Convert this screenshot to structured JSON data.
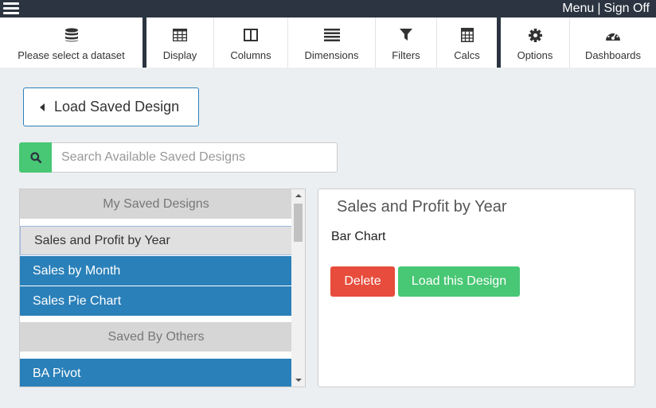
{
  "topbar": {
    "menu_label": "Menu",
    "separator": "|",
    "signoff_label": "Sign Off"
  },
  "toolbar": {
    "dataset_label": "Please select a dataset",
    "display_label": "Display",
    "columns_label": "Columns",
    "dimensions_label": "Dimensions",
    "filters_label": "Filters",
    "calcs_label": "Calcs",
    "options_label": "Options",
    "dashboards_label": "Dashboards"
  },
  "load_button": {
    "label": "Load Saved Design"
  },
  "search": {
    "placeholder": "Search Available Saved Designs",
    "value": ""
  },
  "saved_list": {
    "my_header": "My Saved Designs",
    "my_items": [
      {
        "label": "Sales and Profit by Year",
        "selected": true
      },
      {
        "label": "Sales by Month",
        "selected": false
      },
      {
        "label": "Sales Pie Chart",
        "selected": false
      }
    ],
    "others_header": "Saved By Others",
    "others_items": [
      {
        "label": "BA Pivot",
        "selected": false
      }
    ]
  },
  "detail": {
    "title": "Sales and Profit by Year",
    "type": "Bar Chart",
    "delete_label": "Delete",
    "load_label": "Load this Design"
  },
  "colors": {
    "topbar": "#2b3440",
    "accent_blue": "#2a80b9",
    "success_green": "#48c774",
    "danger_red": "#e74c3c"
  }
}
